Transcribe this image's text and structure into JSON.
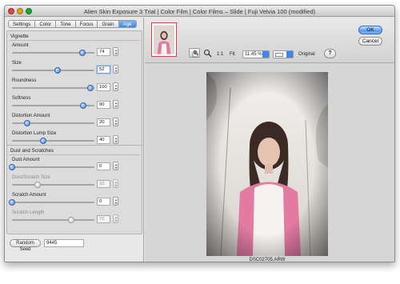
{
  "window": {
    "title": "Alien Skin Exposure 3 Trial | Color Film | Color Films – Slide | Fuji Velvia 100 (modified)"
  },
  "tabs": [
    "Settings",
    "Color",
    "Tone",
    "Focus",
    "Grain",
    "Age"
  ],
  "active_tab": "Age",
  "vignette": {
    "title": "Vignette",
    "controls": [
      {
        "label": "Amount",
        "value": "74",
        "level": 0.85,
        "enabled": true
      },
      {
        "label": "Size",
        "value": "52",
        "level": 0.55,
        "enabled": true,
        "focused": true
      },
      {
        "label": "Roundness",
        "value": "100",
        "level": 0.95,
        "enabled": true
      },
      {
        "label": "Softness",
        "value": "90",
        "level": 0.86,
        "enabled": true
      },
      {
        "label": "Distortion Amount",
        "value": "20",
        "level": 0.18,
        "enabled": true
      },
      {
        "label": "Distortion Lump Size",
        "value": "40",
        "level": 0.38,
        "enabled": true
      }
    ]
  },
  "dust": {
    "title": "Dust and Scratches",
    "controls": [
      {
        "label": "Dust Amount",
        "value": "0",
        "level": 0.0,
        "enabled": true
      },
      {
        "label": "Dust/Scratch Size",
        "value": "33",
        "level": 0.31,
        "enabled": false
      },
      {
        "label": "Scratch Amount",
        "value": "0",
        "level": 0.0,
        "enabled": true
      },
      {
        "label": "Scratch Length",
        "value": "75",
        "level": 0.72,
        "enabled": false
      }
    ]
  },
  "random_seed": {
    "label": "Random Seed",
    "value": "9445"
  },
  "toolbar": {
    "one_to_one": "1:1",
    "fit": "Fit",
    "zoom": "11.45 %",
    "original": "Original",
    "help": "?"
  },
  "buttons": {
    "ok": "OK",
    "cancel": "Cancel"
  },
  "preview": {
    "filename": "DSC02705.ARW"
  },
  "colors": {
    "accent": "#3f86e5",
    "thumb_border": "#d04444"
  },
  "icons": [
    "hand-icon",
    "magnifier-icon",
    "help-icon",
    "split-view-icon"
  ]
}
